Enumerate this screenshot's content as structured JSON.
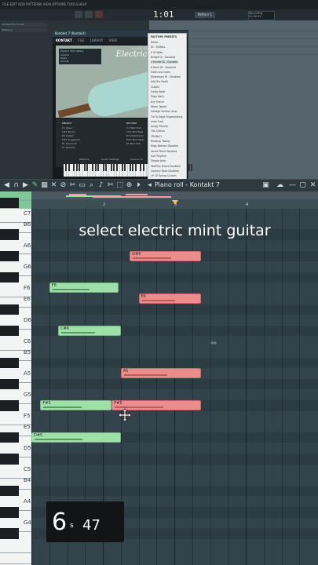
{
  "daw": {
    "menu": "FILE EDIT ADD PATTERNS VIEW OPTIONS TOOLS HELP",
    "time": "1:01",
    "time_sub": "00",
    "pattern_label": "Pattern 1",
    "recording_label": "Recording 20:00:29",
    "left_panel_items": [
      "Kontakt Mint Guitar",
      "Pattern 1",
      "1"
    ]
  },
  "kontakt": {
    "window_title": "Kontakt 7 (Kontakt)",
    "menu_items": [
      "KONTAKT",
      "FILE",
      "LIBRARY",
      "VIEW"
    ],
    "instrument_name": "Electric Mint (Wide)",
    "brand_small": "VOLUME SERIES",
    "brand_title": "Electric Mint",
    "head_labels": [
      "Volume",
      "Mode",
      "Chords"
    ],
    "lower_left_title": "MELODY",
    "lower_left_items": [
      "C1 Open",
      "C#1 Strum",
      "D1 Muted",
      "D#1 Fingerpick",
      "E1 Harmonic",
      "F1 Tremolo"
    ],
    "lower_right_title": "RHYTHM",
    "lower_right_items": [
      "C1 Mint Hum",
      "C#1 Mint Fast",
      "D1 Mint Strum",
      "D#1 Mint Slow",
      "E1 Mint Pick"
    ],
    "bottom_tabs": [
      "Patterns",
      "Guitar Settings",
      "Voice & FX"
    ],
    "factory_title": "FACTORY PRESETS",
    "factory_items": [
      "Reset",
      "DI - SIGNAL",
      "E St Wide",
      "Bridge DI - Doubled",
      "4 Middle DI - Doubled",
      "6 Neck DI - Doubled",
      "Fresh and Open",
      "Distressed DI - Doubled",
      "Into the Seals",
      "CLEAN",
      "Funky Neck",
      "Edgy Neck",
      "Dry Trance",
      "Warm Tweed",
      "Vintage Sunday Amp",
      "Tin To Edge Fingerpicking",
      "Indie Funk",
      "Jangly Rhyme",
      "70s Chorus",
      "CRUNCH",
      "Breakup Twang",
      "Edgy Bottom Doubled",
      "Skunk Piece Doubled",
      "Surf Rhythm",
      "Simple Amp",
      "TelePlus Direct Doubled",
      "Country Rock Doubled",
      "LP 70 Tuning Crunch"
    ]
  },
  "piano_roll": {
    "title": "Piano roll - Kontakt 7",
    "ruler": [
      "2",
      "3",
      "4"
    ],
    "key_labels": [
      "C7",
      "B6",
      "A6",
      "G6",
      "F6",
      "E6",
      "D6",
      "C6",
      "B5",
      "A5",
      "G5",
      "F5",
      "E5",
      "D5",
      "C5",
      "B4",
      "A4",
      "G4"
    ],
    "notes": [
      {
        "label": "G#6",
        "color": "red"
      },
      {
        "label": "F6",
        "color": "green"
      },
      {
        "label": "E6",
        "color": "red"
      },
      {
        "label": "C#6",
        "color": "green"
      },
      {
        "label": "A5",
        "color": "red"
      },
      {
        "label": "F#5",
        "color": "green"
      },
      {
        "label": "F#5",
        "color": "red"
      },
      {
        "label": "D#5",
        "color": "green"
      }
    ]
  },
  "overlay": {
    "caption": "select electric mint guitar",
    "timer_seconds": "6",
    "timer_unit": "s",
    "timer_ms": "47"
  },
  "colors": {
    "note_green": "#9fe0a9",
    "note_red": "#eb8d8d",
    "grid_bg": "#33434b",
    "playhead": "#f3c24a"
  }
}
